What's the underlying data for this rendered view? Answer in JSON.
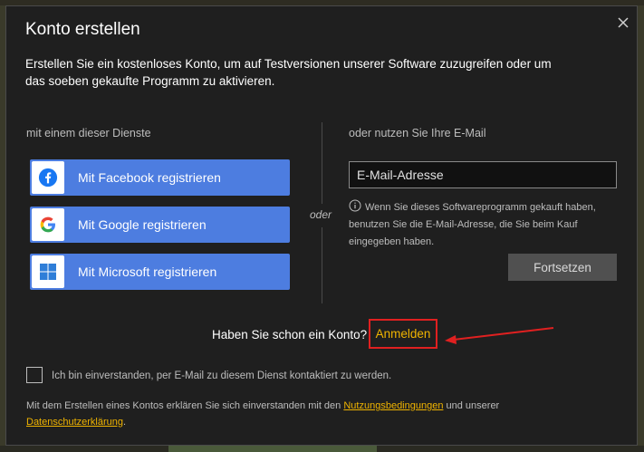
{
  "dialog": {
    "title": "Konto erstellen",
    "subtitle": "Erstellen Sie ein kostenloses Konto, um auf Testversionen unserer Software zuzugreifen oder um das soeben gekaufte Programm zu aktivieren."
  },
  "left": {
    "label": "mit einem dieser Dienste",
    "buttons": [
      {
        "label": "Mit Facebook registrieren",
        "icon": "facebook-icon"
      },
      {
        "label": "Mit Google registrieren",
        "icon": "google-icon"
      },
      {
        "label": "Mit Microsoft registrieren",
        "icon": "microsoft-icon"
      }
    ]
  },
  "separator": "oder",
  "right": {
    "label": "oder nutzen Sie Ihre E-Mail",
    "email_placeholder": "E-Mail-Adresse",
    "info": "Wenn Sie dieses Softwareprogramm gekauft haben, benutzen Sie die E-Mail-Adresse, die Sie beim Kauf eingegeben haben.",
    "continue_label": "Fortsetzen"
  },
  "login": {
    "question": "Haben Sie schon ein Konto?",
    "link": "Anmelden"
  },
  "consent": "Ich bin einverstanden, per E-Mail zu diesem Dienst kontaktiert zu werden.",
  "footer": {
    "prefix": "Mit dem Erstellen eines Kontos erklären Sie sich einverstanden mit den",
    "terms": "Nutzungsbedingungen",
    "middle": "und unserer",
    "privacy": "Datenschutzerklärung",
    "suffix": "."
  },
  "colors": {
    "dialog_bg": "#1f1f1f",
    "social_button": "#4d7de0",
    "link": "#f0b400",
    "highlight": "#e02020"
  }
}
